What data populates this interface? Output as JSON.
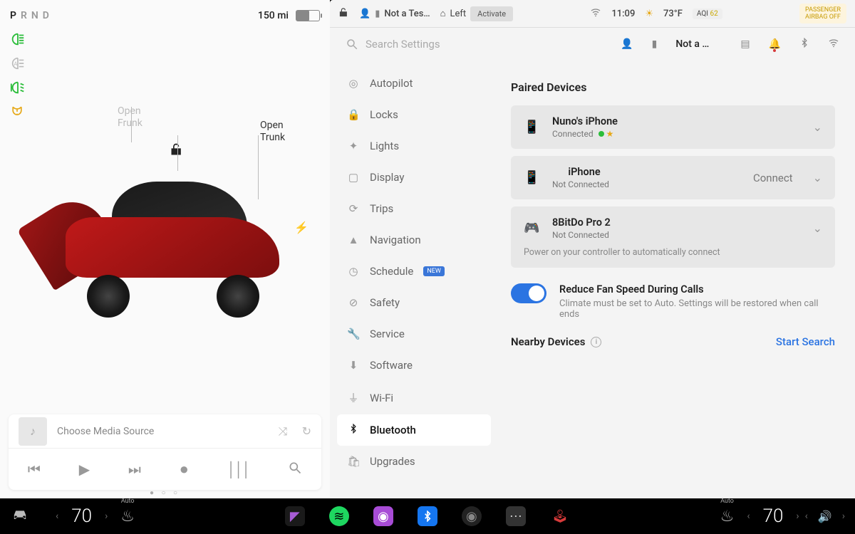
{
  "left": {
    "gear": {
      "p": "P",
      "r": "R",
      "n": "N",
      "d": "D",
      "active": "P"
    },
    "range": "150 mi",
    "frunk": {
      "line1": "Open",
      "line2": "Frunk"
    },
    "trunk": {
      "line1": "Open",
      "line2": "Trunk"
    },
    "media": {
      "source": "Choose Media Source"
    }
  },
  "status": {
    "profile": "Not a Tes…",
    "homelink": "Left",
    "activate": "Activate",
    "time": "11:09",
    "temp": "73°F",
    "aqi_label": "AQI",
    "aqi_value": "62",
    "airbag_l1": "PASSENGER",
    "airbag_l2": "AIRBAG OFF"
  },
  "settings": {
    "search_placeholder": "Search Settings",
    "profile_name": "Not a …",
    "nav": {
      "autopilot": "Autopilot",
      "locks": "Locks",
      "lights": "Lights",
      "display": "Display",
      "trips": "Trips",
      "navigation": "Navigation",
      "schedule": "Schedule",
      "schedule_badge": "NEW",
      "safety": "Safety",
      "service": "Service",
      "software": "Software",
      "wifi": "Wi-Fi",
      "bluetooth": "Bluetooth",
      "upgrades": "Upgrades"
    },
    "paired_title": "Paired Devices",
    "devices": [
      {
        "name": "Nuno's iPhone",
        "status": "Connected",
        "connected": true,
        "favorite": true,
        "icon": "phone"
      },
      {
        "name": "iPhone",
        "status": "Not Connected",
        "connected": false,
        "action": "Connect",
        "icon": "phone"
      },
      {
        "name": "8BitDo Pro 2",
        "status": "Not Connected",
        "connected": false,
        "icon": "gamepad",
        "helper": "Power on your controller to automatically connect"
      }
    ],
    "toggle": {
      "label": "Reduce Fan Speed During Calls",
      "desc": "Climate must be set to Auto. Settings will be restored when call ends",
      "on": true
    },
    "nearby_title": "Nearby Devices",
    "start_search": "Start Search"
  },
  "bottom": {
    "temp_left": "70",
    "temp_right": "70",
    "auto": "Auto"
  }
}
